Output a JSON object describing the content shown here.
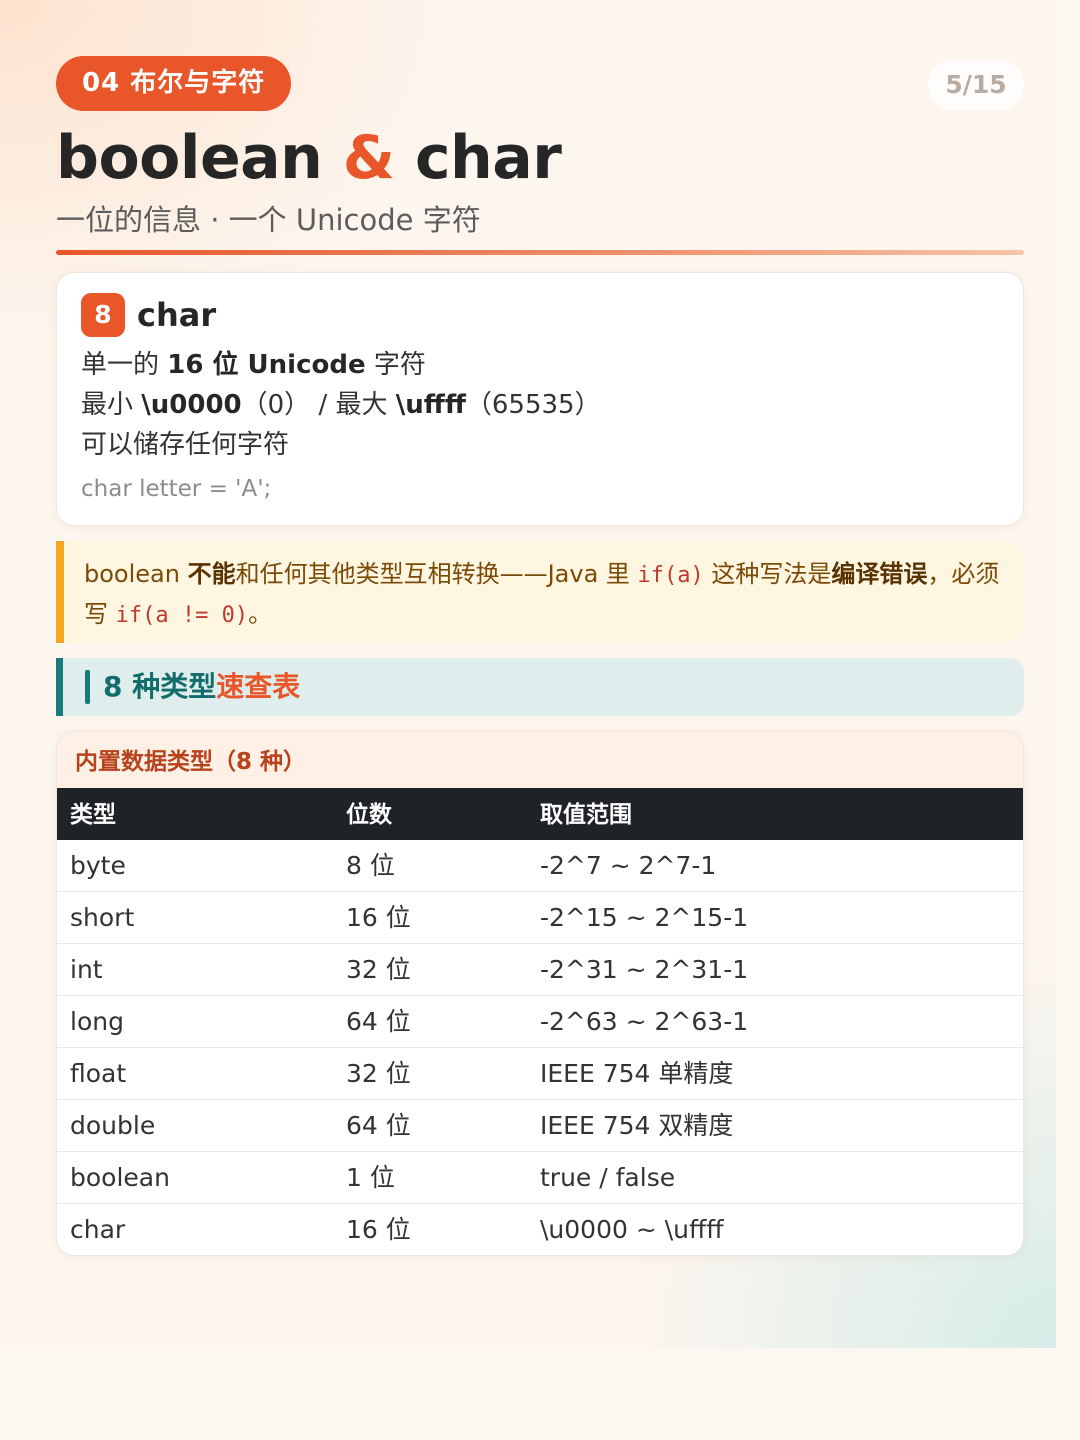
{
  "header": {
    "chapter": "04 布尔与字符",
    "page_counter": "5/15",
    "title_left": "boolean",
    "title_amp": "&",
    "title_right": "char",
    "subtitle": "一位的信息 · 一个 Unicode 字符"
  },
  "char_card": {
    "number": "8",
    "title": "char",
    "line1_pre": "单一的 ",
    "line1_bold": "16 位 Unicode",
    "line1_post": " 字符",
    "line2_pre": "最小 ",
    "line2_bold1": "\\u0000",
    "line2_mid": "（0） / 最大 ",
    "line2_bold2": "\\uffff",
    "line2_post": "（65535）",
    "line3": "可以储存任何字符",
    "code": "char letter = 'A';"
  },
  "warning": {
    "t1": "boolean ",
    "b1": "不能",
    "t2": "和任何其他类型互相转换——Java 里 ",
    "code1": "if(a)",
    "t3": " 这种写法是",
    "b2": "编译错误",
    "t4": "，必须写 ",
    "code2": "if(a != 0)",
    "t5": "。"
  },
  "section": {
    "title": "8 种类型",
    "title_highlight": "速查表"
  },
  "table": {
    "caption": "内置数据类型（8 种）",
    "headers": [
      "类型",
      "位数",
      "取值范围"
    ],
    "rows": [
      [
        "byte",
        "8 位",
        "-2^7 ~ 2^7-1"
      ],
      [
        "short",
        "16 位",
        "-2^15 ~ 2^15-1"
      ],
      [
        "int",
        "32 位",
        "-2^31 ~ 2^31-1"
      ],
      [
        "long",
        "64 位",
        "-2^63 ~ 2^63-1"
      ],
      [
        "float",
        "32 位",
        "IEEE 754 单精度"
      ],
      [
        "double",
        "64 位",
        "IEEE 754 双精度"
      ],
      [
        "boolean",
        "1 位",
        "true / false"
      ],
      [
        "char",
        "16 位",
        "\\u0000 ~ \\uffff"
      ]
    ]
  },
  "colors": {
    "accent": "#e8562a",
    "teal": "#167b7a",
    "warning_border": "#f5a623",
    "table_head": "#1f2328"
  }
}
